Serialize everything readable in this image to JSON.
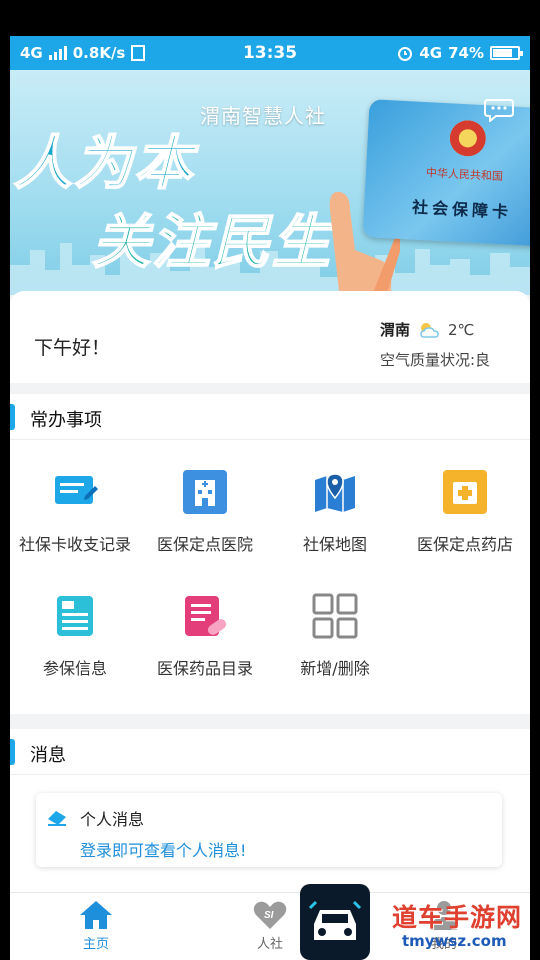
{
  "status_bar": {
    "network": "4G",
    "speed": "0.8K/s",
    "time": "13:35",
    "network_right": "4G",
    "battery": "74%",
    "battery_level": 0.74
  },
  "banner": {
    "title": "渭南智慧人社",
    "slogan_line1": "人为本",
    "slogan_line2": "关注民生",
    "card_line1": "中华人民共和国",
    "card_line2": "社会保障卡",
    "active_slide": 1,
    "slide_count": 3
  },
  "greeting": {
    "text": "下午好！",
    "city": "渭南",
    "temperature": "2℃",
    "air_quality": "空气质量状况:良"
  },
  "common": {
    "title": "常办事项",
    "items": [
      {
        "label": "社保卡收支记录",
        "icon": "card-record-icon"
      },
      {
        "label": "医保定点医院",
        "icon": "hospital-icon"
      },
      {
        "label": "社保地图",
        "icon": "map-icon"
      },
      {
        "label": "医保定点药店",
        "icon": "pharmacy-icon"
      },
      {
        "label": "参保信息",
        "icon": "insurance-info-icon"
      },
      {
        "label": "医保药品目录",
        "icon": "drug-catalog-icon"
      },
      {
        "label": "新增/删除",
        "icon": "grid-add-icon"
      }
    ]
  },
  "messages": {
    "title": "消息",
    "card_title": "个人消息",
    "card_text": "登录即可查看个人消息!"
  },
  "tabbar": {
    "home": "主页",
    "social": "人社",
    "mine": "我的"
  },
  "watermark": {
    "text": "道车手游网",
    "url": "tmywsz.com"
  },
  "colors": {
    "accent": "#1ea7e8",
    "link": "#1e8fdb"
  }
}
